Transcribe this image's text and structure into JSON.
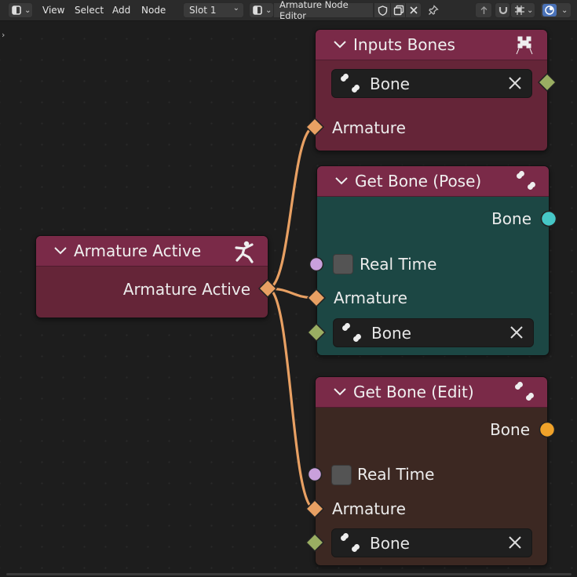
{
  "header": {
    "menus": [
      "View",
      "Select",
      "Add",
      "Node"
    ],
    "slot": "Slot 1",
    "tree_name": "Armature Node Editor"
  },
  "nodes": {
    "inputs_bones": {
      "title": "Inputs Bones",
      "field": "Bone",
      "armature": "Armature"
    },
    "get_bone_pose": {
      "title": "Get Bone (Pose)",
      "bone_out": "Bone",
      "real_time": "Real Time",
      "armature": "Armature",
      "field": "Bone"
    },
    "armature_active": {
      "title": "Armature Active",
      "output": "Armature Active"
    },
    "get_bone_edit": {
      "title": "Get Bone (Edit)",
      "bone_out": "Bone",
      "real_time": "Real Time",
      "armature": "Armature",
      "field": "Bone"
    }
  },
  "colors": {
    "armature_header": "#7a2a48",
    "armature_body": "#652538",
    "pose_body": "#1c4744",
    "edit_body": "#3c2822",
    "link": "#e8a063",
    "armature_socket": "#e8a063",
    "bone_socket": "#9aae62",
    "cyan_socket": "#46c7c7",
    "orange_socket": "#f0a22a",
    "bool_socket": "#c9a0dc"
  }
}
